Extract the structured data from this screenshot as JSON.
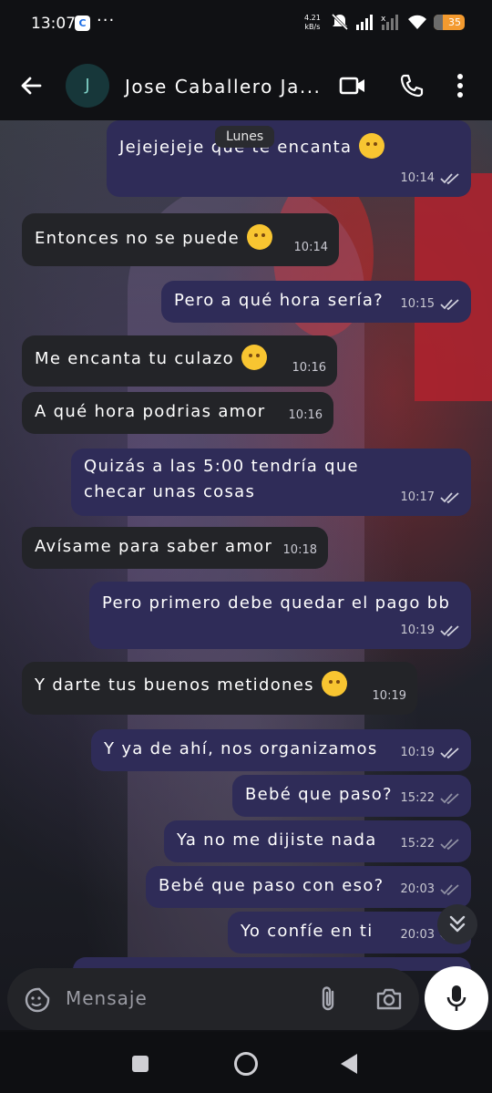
{
  "status_bar": {
    "time": "13:07",
    "calendar_glyph": "C",
    "dots": "···",
    "net_speed": "4.21",
    "net_unit": "kB/s",
    "battery": "35"
  },
  "header": {
    "avatar_letter": "J",
    "contact_name": "Jose Caballero Ja..."
  },
  "chat": {
    "date_label": "Lunes",
    "messages": [
      {
        "text": "Jejejejeje que te encanta",
        "time": "10:14",
        "dir": "out",
        "emoji": true
      },
      {
        "text": "Entonces no se puede",
        "time": "10:14",
        "dir": "in",
        "emoji": true
      },
      {
        "text": "Pero a qué hora sería?",
        "time": "10:15",
        "dir": "out",
        "emoji": false
      },
      {
        "text": "Me encanta tu culazo",
        "time": "10:16",
        "dir": "in",
        "emoji": true
      },
      {
        "text": "A qué hora podrias amor",
        "time": "10:16",
        "dir": "in",
        "emoji": false
      },
      {
        "text": "Quizás a las 5:00 tendría que checar unas cosas",
        "time": "10:17",
        "dir": "out",
        "emoji": false
      },
      {
        "text": "Avísame para saber amor",
        "time": "10:18",
        "dir": "in",
        "emoji": false
      },
      {
        "text": "Pero primero debe quedar el pago bb",
        "time": "10:19",
        "dir": "out",
        "emoji": false
      },
      {
        "text": "Y darte tus buenos metidones",
        "time": "10:19",
        "dir": "in",
        "emoji": true
      },
      {
        "text": "Y ya de ahí, nos organizamos",
        "time": "10:19",
        "dir": "out",
        "emoji": false
      },
      {
        "text": "Bebé que paso?",
        "time": "15:22",
        "dir": "out",
        "emoji": false
      },
      {
        "text": "Ya no me dijiste nada",
        "time": "15:22",
        "dir": "out",
        "emoji": false
      },
      {
        "text": "Bebé que paso con eso?",
        "time": "20:03",
        "dir": "out",
        "emoji": false
      },
      {
        "text": "Yo confíe en ti",
        "time": "20:03",
        "dir": "out",
        "emoji": false
      }
    ]
  },
  "composer": {
    "placeholder": "Mensaje"
  },
  "icons": {
    "back": "arrow-left-icon",
    "video": "video-camera-icon",
    "call": "phone-icon",
    "more": "more-vert-icon",
    "sticker": "sticker-icon",
    "attach": "paperclip-icon",
    "camera": "camera-icon",
    "mic": "microphone-icon",
    "scroll": "double-chevron-down-icon"
  },
  "colors": {
    "outgoing_bubble": "#2f2c58",
    "incoming_bubble": "#232428",
    "battery": "#f39a2f"
  }
}
